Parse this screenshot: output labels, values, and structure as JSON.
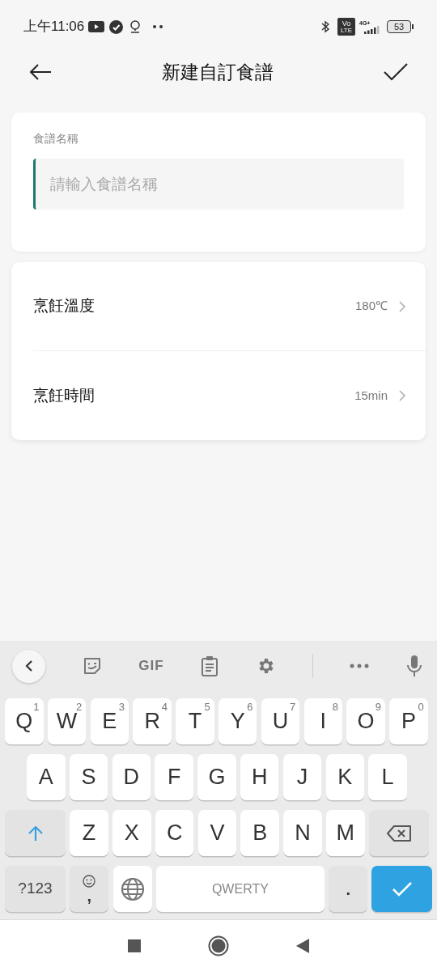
{
  "status_bar": {
    "time": "上午11:06",
    "volte_top": "Vo",
    "volte_bottom": "LTE",
    "network": "4G+",
    "battery": "53"
  },
  "header": {
    "title": "新建自訂食譜"
  },
  "name_card": {
    "label": "食譜名稱",
    "placeholder": "請輸入食譜名稱"
  },
  "settings": [
    {
      "label": "烹飪溫度",
      "value": "180℃"
    },
    {
      "label": "烹飪時間",
      "value": "15min"
    }
  ],
  "keyboard": {
    "toolbar_gif": "GIF",
    "rows": [
      [
        {
          "kind": "letter",
          "label": "Q",
          "hint": "1"
        },
        {
          "kind": "letter",
          "label": "W",
          "hint": "2"
        },
        {
          "kind": "letter",
          "label": "E",
          "hint": "3"
        },
        {
          "kind": "letter",
          "label": "R",
          "hint": "4"
        },
        {
          "kind": "letter",
          "label": "T",
          "hint": "5"
        },
        {
          "kind": "letter",
          "label": "Y",
          "hint": "6"
        },
        {
          "kind": "letter",
          "label": "U",
          "hint": "7"
        },
        {
          "kind": "letter",
          "label": "I",
          "hint": "8"
        },
        {
          "kind": "letter",
          "label": "O",
          "hint": "9"
        },
        {
          "kind": "letter",
          "label": "P",
          "hint": "0"
        }
      ],
      [
        {
          "kind": "letter",
          "label": "A"
        },
        {
          "kind": "letter",
          "label": "S"
        },
        {
          "kind": "letter",
          "label": "D"
        },
        {
          "kind": "letter",
          "label": "F"
        },
        {
          "kind": "letter",
          "label": "G"
        },
        {
          "kind": "letter",
          "label": "H"
        },
        {
          "kind": "letter",
          "label": "J"
        },
        {
          "kind": "letter",
          "label": "K"
        },
        {
          "kind": "letter",
          "label": "L"
        }
      ],
      [
        {
          "kind": "shift"
        },
        {
          "kind": "letter",
          "label": "Z"
        },
        {
          "kind": "letter",
          "label": "X"
        },
        {
          "kind": "letter",
          "label": "C"
        },
        {
          "kind": "letter",
          "label": "V"
        },
        {
          "kind": "letter",
          "label": "B"
        },
        {
          "kind": "letter",
          "label": "N"
        },
        {
          "kind": "letter",
          "label": "M"
        },
        {
          "kind": "backspace"
        }
      ]
    ],
    "bottom_row": [
      {
        "kind": "symbols",
        "label": "?123"
      },
      {
        "kind": "comma",
        "label": ","
      },
      {
        "kind": "globe"
      },
      {
        "kind": "space",
        "label": "QWERTY"
      },
      {
        "kind": "period",
        "label": "."
      },
      {
        "kind": "enter"
      }
    ]
  }
}
